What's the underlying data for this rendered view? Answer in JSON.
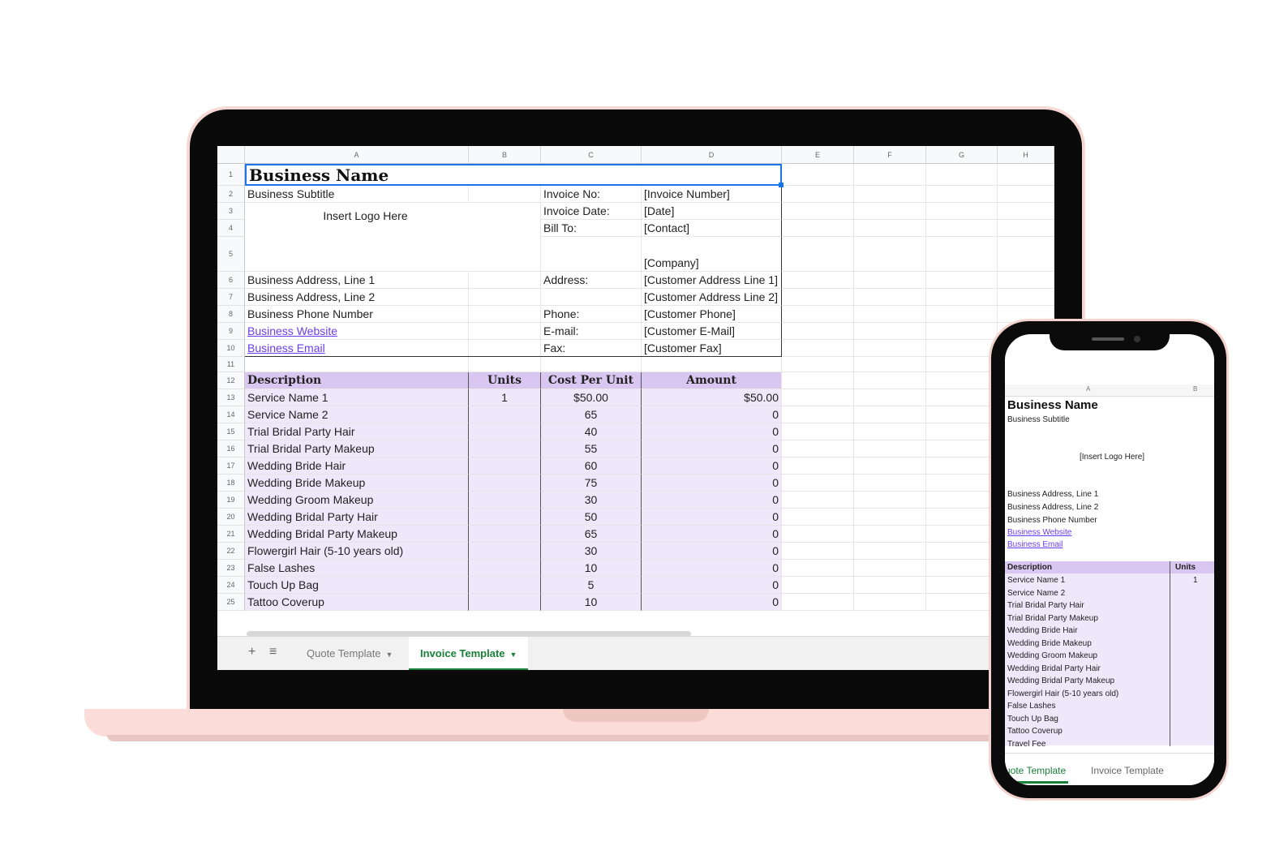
{
  "columns": [
    "A",
    "B",
    "C",
    "D",
    "E",
    "F",
    "G",
    "H"
  ],
  "rows": [
    "1",
    "2",
    "3",
    "4",
    "5",
    "6",
    "7",
    "8",
    "9",
    "10",
    "11",
    "12",
    "13",
    "14",
    "15",
    "16",
    "17",
    "18",
    "19",
    "20",
    "21",
    "22",
    "23",
    "24",
    "25"
  ],
  "header": {
    "business_name": "Business Name",
    "business_subtitle": "Business Subtitle",
    "logo_placeholder": "Insert Logo Here",
    "address_line1": "Business Address, Line 1",
    "address_line2": "Business Address, Line 2",
    "phone": "Business Phone Number",
    "website": "Business Website",
    "email": "Business Email",
    "invoice_no_label": "Invoice No:",
    "invoice_no_value": "[Invoice Number]",
    "invoice_date_label": "Invoice Date:",
    "invoice_date_value": "[Date]",
    "bill_to_label": "Bill To:",
    "bill_to_value": "[Contact]",
    "company_value": "[Company]",
    "address_label": "Address:",
    "cust_addr1": "[Customer Address Line 1]",
    "cust_addr2": "[Customer Address Line 2]",
    "phone_label": "Phone:",
    "cust_phone": "[Customer Phone]",
    "email_label": "E-mail:",
    "cust_email": "[Customer E-Mail]",
    "fax_label": "Fax:",
    "cust_fax": "[Customer Fax]"
  },
  "table": {
    "headers": [
      "Description",
      "Units",
      "Cost Per Unit",
      "Amount"
    ],
    "rows": [
      {
        "description": "Service Name 1",
        "units": "1",
        "cost": "$50.00",
        "amount": "$50.00"
      },
      {
        "description": "Service Name 2",
        "units": "",
        "cost": "65",
        "amount": "0"
      },
      {
        "description": "Trial Bridal Party Hair",
        "units": "",
        "cost": "40",
        "amount": "0"
      },
      {
        "description": "Trial Bridal Party Makeup",
        "units": "",
        "cost": "55",
        "amount": "0"
      },
      {
        "description": "Wedding Bride Hair",
        "units": "",
        "cost": "60",
        "amount": "0"
      },
      {
        "description": "Wedding Bride Makeup",
        "units": "",
        "cost": "75",
        "amount": "0"
      },
      {
        "description": "Wedding Groom Makeup",
        "units": "",
        "cost": "30",
        "amount": "0"
      },
      {
        "description": "Wedding Bridal Party Hair",
        "units": "",
        "cost": "50",
        "amount": "0"
      },
      {
        "description": "Wedding Bridal Party Makeup",
        "units": "",
        "cost": "65",
        "amount": "0"
      },
      {
        "description": "Flowergirl Hair (5-10 years old)",
        "units": "",
        "cost": "30",
        "amount": "0"
      },
      {
        "description": "False Lashes",
        "units": "",
        "cost": "10",
        "amount": "0"
      },
      {
        "description": "Touch Up Bag",
        "units": "",
        "cost": "5",
        "amount": "0"
      },
      {
        "description": "Tattoo Coverup",
        "units": "",
        "cost": "10",
        "amount": "0"
      }
    ]
  },
  "tabs": {
    "add": "+",
    "menu": "≡",
    "quote": "Quote Template",
    "invoice": "Invoice Template"
  },
  "phone": {
    "col_a": "A",
    "col_b": "B",
    "business_name": "Business Name",
    "business_subtitle": "Business Subtitle",
    "logo_placeholder": "[Insert Logo Here]",
    "address_line1": "Business Address, Line 1",
    "address_line2": "Business Address, Line 2",
    "phone": "Business Phone Number",
    "website": "Business Website",
    "email": "Business Email",
    "desc_header": "Description",
    "units_header": "Units",
    "first_units": "1",
    "items": [
      "Service Name 1",
      "Service Name 2",
      "Trial Bridal Party Hair",
      "Trial Bridal Party Makeup",
      "Wedding Bride Hair",
      "Wedding Bride Makeup",
      "Wedding Groom Makeup",
      "Wedding Bridal Party Hair",
      "Wedding Bridal Party Makeup",
      "Flowergirl Hair (5-10 years old)",
      "False Lashes",
      "Touch Up Bag",
      "Tattoo Coverup",
      "Travel Fee"
    ],
    "tab_quote": "uote Template",
    "tab_invoice": "Invoice Template"
  },
  "colors": {
    "accent_purple": "#d9c7f2",
    "row_purple": "#efe7fa",
    "link": "#6a3df0",
    "active_tab": "#188038",
    "device_pink": "#fbdcd8"
  }
}
